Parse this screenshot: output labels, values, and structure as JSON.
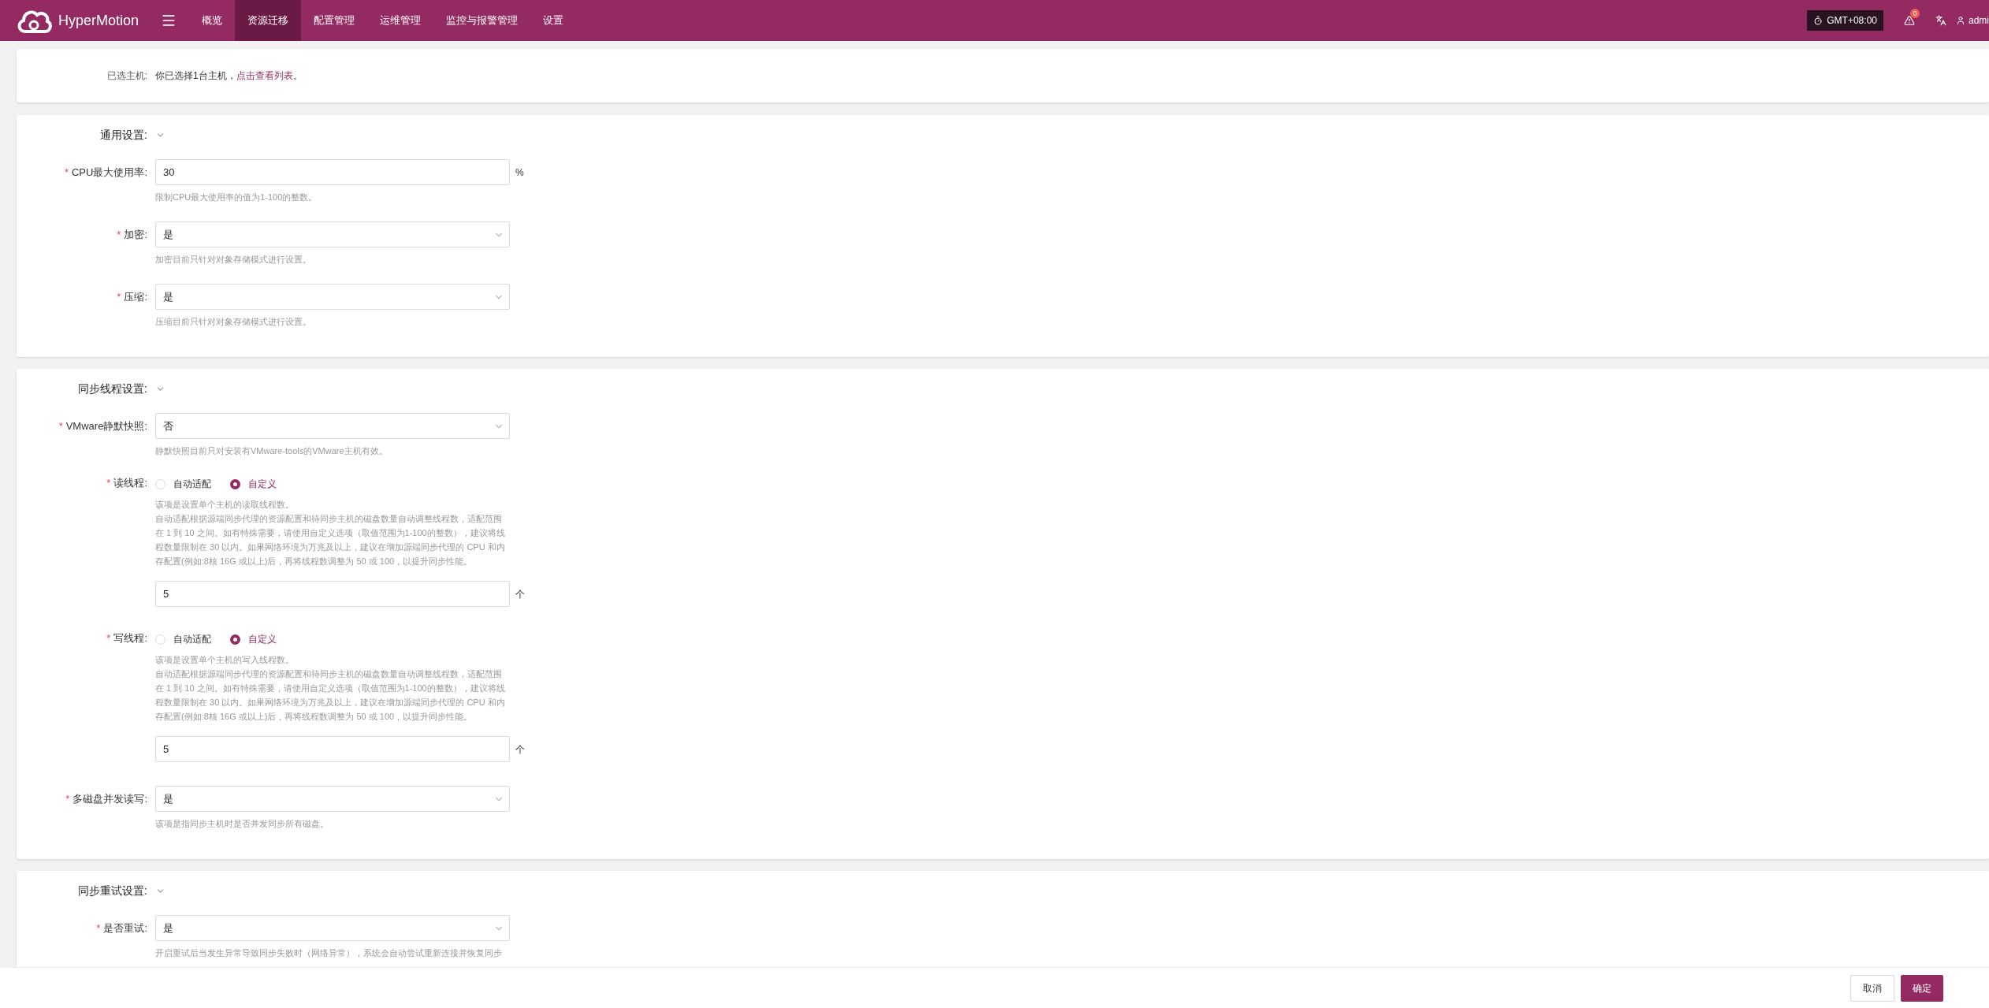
{
  "nav": {
    "brand": "HyperMotion",
    "items": [
      {
        "label": "概览",
        "selected": false
      },
      {
        "label": "资源迁移",
        "selected": true
      },
      {
        "label": "配置管理",
        "selected": false
      },
      {
        "label": "运维管理",
        "selected": false
      },
      {
        "label": "监控与报警管理",
        "selected": false
      },
      {
        "label": "设置",
        "selected": false
      }
    ],
    "timezone": "GMT+08:00",
    "alert_count": "0",
    "user": "admi"
  },
  "selected_hosts": {
    "label": "已选主机:",
    "text": "你已选择1台主机，",
    "link": "点击查看列表",
    "tail": "。"
  },
  "sections": [
    {
      "title": "通用设置:",
      "expanded": true,
      "fields": [
        {
          "kind": "input",
          "mark": "*",
          "label": "CPU最大使用率:",
          "value": "30",
          "unit": "%",
          "hint": [
            "限制CPU最大使用率的值为1-100的整数。"
          ]
        },
        {
          "kind": "select",
          "mark": "*",
          "label": "加密:",
          "value": "是",
          "hint": [
            "加密目前只针对对象存储模式进行设置。"
          ]
        },
        {
          "kind": "select",
          "mark": "*",
          "label": "压缩:",
          "value": "是",
          "hint": [
            "压缩目前只针对对象存储模式进行设置。"
          ]
        }
      ]
    },
    {
      "title": "同步线程设置:",
      "expanded": true,
      "fields": [
        {
          "kind": "select",
          "mark": "*",
          "label": "VMware静默快照:",
          "value": "否",
          "hint": [
            "静默快照目前只对安装有VMware-tools的VMware主机有效。"
          ]
        },
        {
          "kind": "radio",
          "mark": "*",
          "label": "读线程:",
          "options": [
            {
              "label": "自动适配",
              "selected": false
            },
            {
              "label": "自定义",
              "selected": true
            }
          ],
          "hint": [
            "该项是设置单个主机的读取线程数。",
            "自动适配根据源端同步代理的资源配置和待同步主机的磁盘数量自动调整线程数，适配范围在 1 到 10 之间。如有特殊需要，请使用自定义选项（取值范围为1-100的整数），建议将线程数量限制在 30 以内。如果网络环境为万兆及以上，建议在增加源端同步代理的 CPU 和内存配置(例如:8核 16G 或以上)后，再将线程数调整为 50 或 100，以提升同步性能。"
          ],
          "value": "5",
          "unit": "个"
        },
        {
          "kind": "radio",
          "mark": "*",
          "label": "写线程:",
          "options": [
            {
              "label": "自动适配",
              "selected": false
            },
            {
              "label": "自定义",
              "selected": true
            }
          ],
          "hint": [
            "该项是设置单个主机的写入线程数。",
            "自动适配根据源端同步代理的资源配置和待同步主机的磁盘数量自动调整线程数，适配范围在 1 到 10 之间。如有特殊需要，请使用自定义选项（取值范围为1-100的整数），建议将线程数量限制在 30 以内。如果网络环境为万兆及以上，建议在增加源端同步代理的 CPU 和内存配置(例如:8核 16G 或以上)后，再将线程数调整为 50 或 100，以提升同步性能。"
          ],
          "value": "5",
          "unit": "个"
        },
        {
          "kind": "select",
          "mark": "*",
          "label": "多磁盘并发读写:",
          "value": "是",
          "hint": [
            "该项是指同步主机时是否并发同步所有磁盘。"
          ]
        }
      ]
    },
    {
      "title": "同步重试设置:",
      "expanded": true,
      "fields": [
        {
          "kind": "select",
          "mark": "*",
          "label": "是否重试:",
          "value": "是",
          "hint": [
            "开启重试后当发生异常导致同步失败时（网络异常），系统会自动尝试重新连接并恢复同步"
          ]
        }
      ]
    }
  ],
  "footer": {
    "buttons": [
      {
        "label": "取消",
        "kind": "secondary"
      },
      {
        "label": "确定",
        "kind": "primary"
      }
    ]
  }
}
